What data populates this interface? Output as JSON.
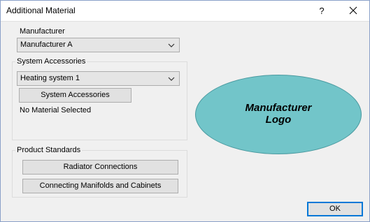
{
  "window": {
    "title": "Additional Material",
    "help_label": "?",
    "close_icon": "close-icon"
  },
  "manufacturer": {
    "label": "Manufacturer",
    "selected": "Manufacturer A"
  },
  "system_accessories": {
    "group_label": "System Accessories",
    "selected": "Heating system 1",
    "button_label": "System Accessories",
    "status_text": "No Material Selected"
  },
  "logo": {
    "line1": "Manufacturer",
    "line2": "Logo",
    "fill_color": "#72c5c9"
  },
  "product_standards": {
    "group_label": "Product Standards",
    "radiator_button": "Radiator Connections",
    "manifolds_button": "Connecting Manifolds and Cabinets"
  },
  "footer": {
    "ok_label": "OK",
    "accent_color": "#0078d7"
  }
}
